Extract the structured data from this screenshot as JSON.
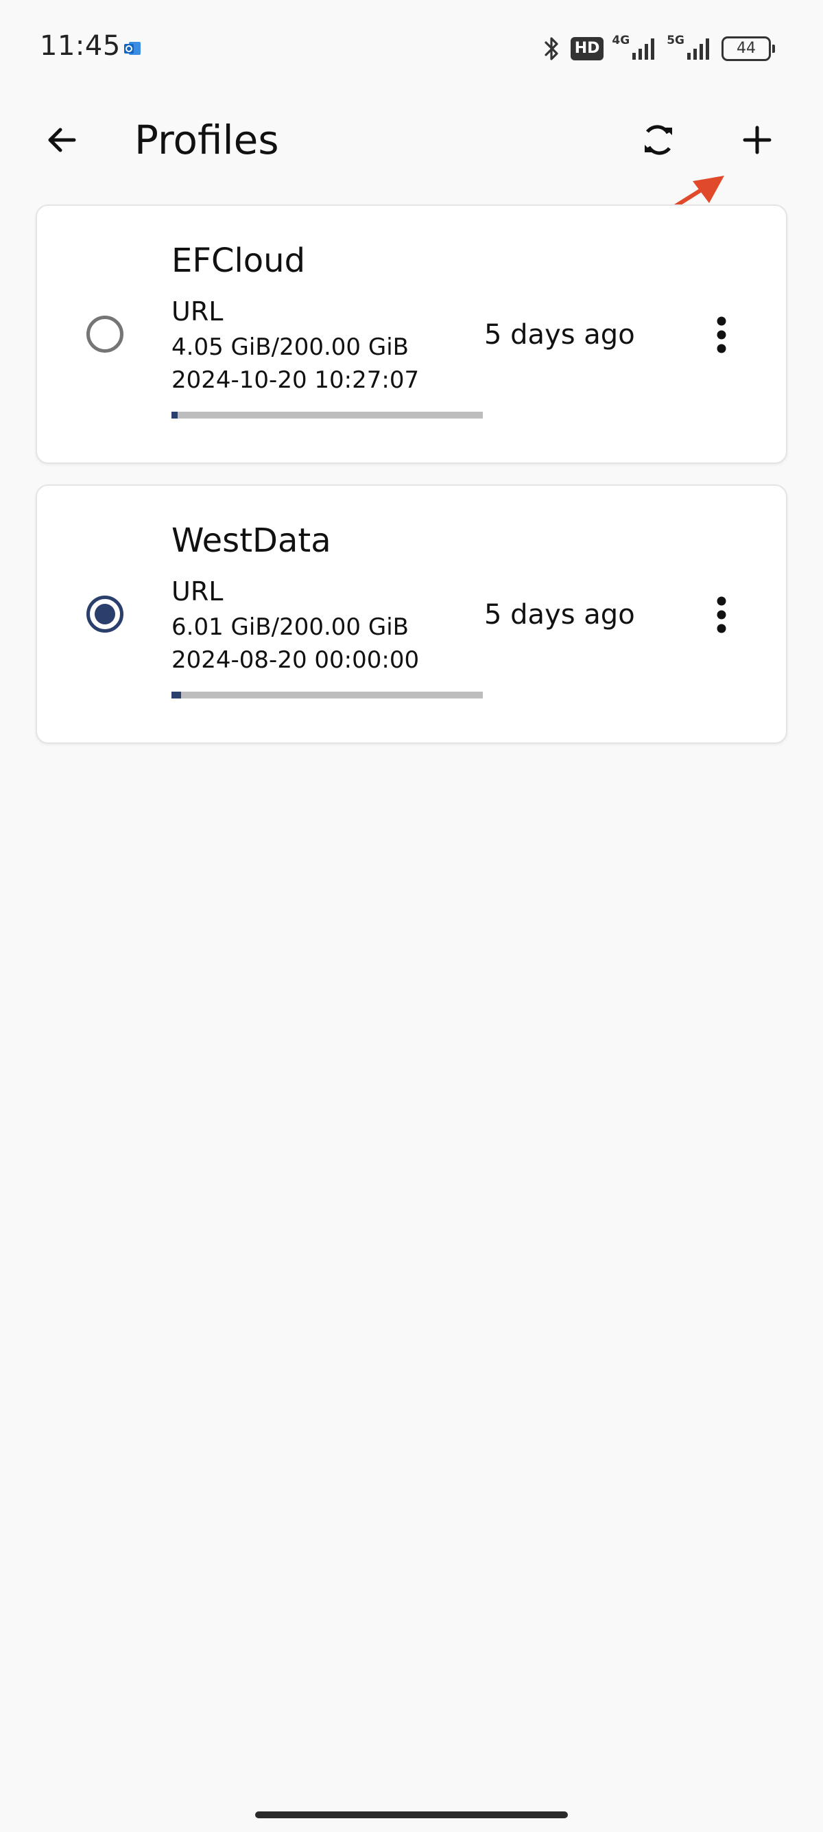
{
  "status_bar": {
    "time": "11:45",
    "network_1": "4G",
    "network_2": "5G",
    "hd_badge": "HD",
    "battery": "44",
    "icons": [
      "outlook-icon",
      "bluetooth-icon",
      "signal-icon",
      "battery-icon"
    ]
  },
  "app_bar": {
    "title": "Profiles",
    "icons": [
      "back-arrow-icon",
      "sync-icon",
      "plus-icon"
    ]
  },
  "profiles": [
    {
      "name": "EFCloud",
      "type": "URL",
      "usage": "4.05 GiB/200.00 GiB",
      "expiry": "2024-10-20 10:27:07",
      "updated": "5 days ago",
      "usage_fraction": 0.02025,
      "selected": false
    },
    {
      "name": "WestData",
      "type": "URL",
      "usage": "6.01 GiB/200.00 GiB",
      "expiry": "2024-08-20 00:00:00",
      "updated": "5 days ago",
      "usage_fraction": 0.03005,
      "selected": true
    }
  ],
  "colors": {
    "accent": "#2b3f6c",
    "progress_track": "#bdbdbd",
    "annotation_arrow": "#e04a2a",
    "background": "#f9f9f9"
  }
}
